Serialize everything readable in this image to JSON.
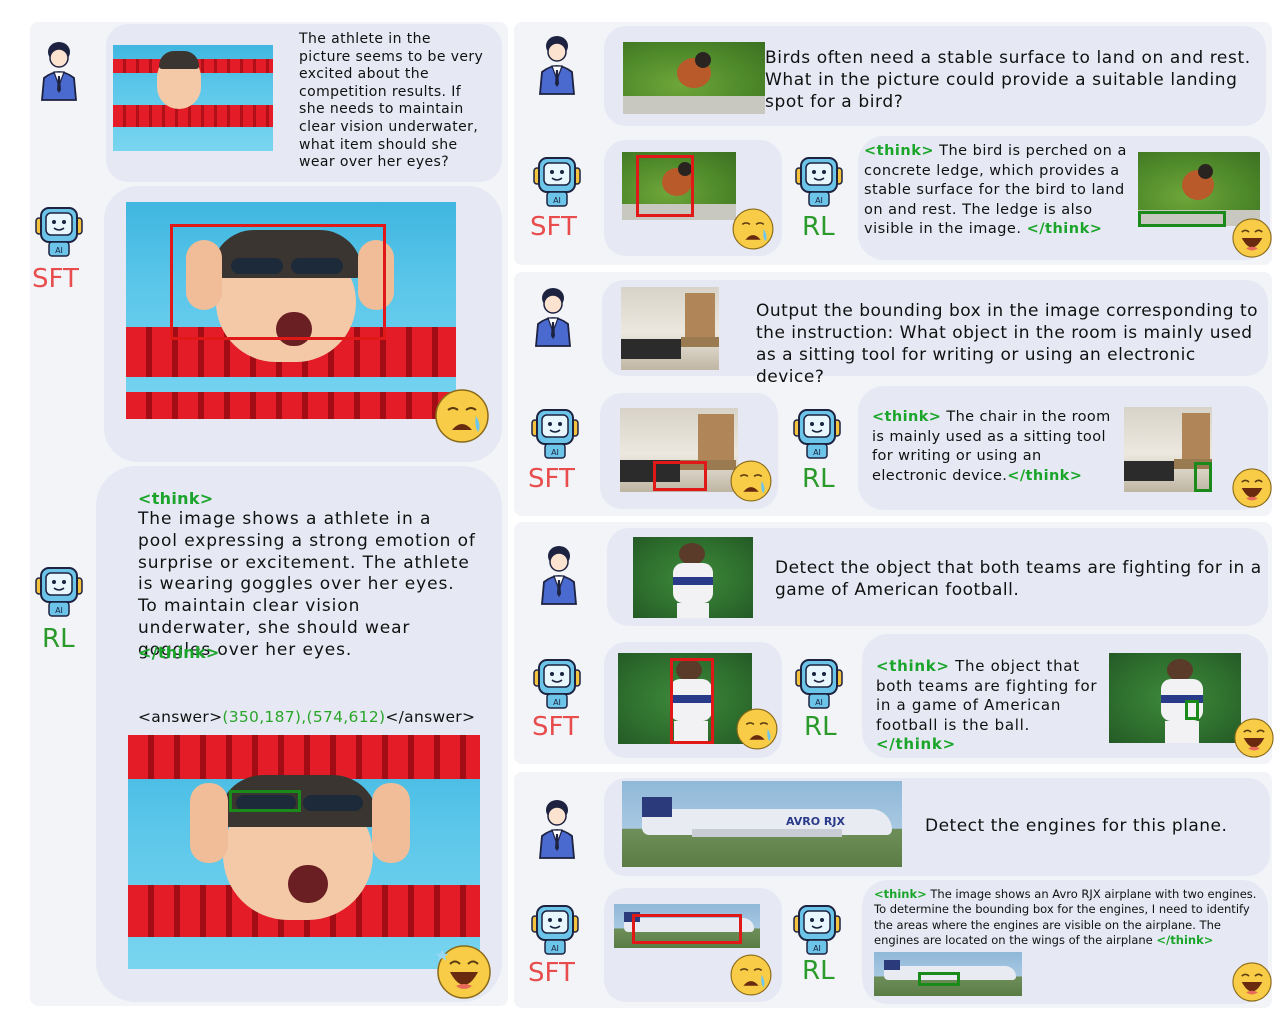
{
  "labels": {
    "sft": "SFT",
    "rl": "RL"
  },
  "colors": {
    "sft": "#e84c4c",
    "rl": "#2a9a2a",
    "think": "#1aa52a",
    "bbox_sft": "#e01818",
    "bbox_rl": "#1a8a1a"
  },
  "icons": {
    "user": "user-avatar-icon",
    "robot": "robot-ai-icon",
    "sad": "crying-face-icon",
    "happy": "happy-face-icon"
  },
  "left": {
    "question": "The athlete in the picture seems to be very excited about the competition results. If she needs to maintain clear vision underwater, what item should she wear over her eyes?",
    "rl_think_open": "<think>",
    "rl_text": "The image shows a athlete in a pool expressing a strong emotion of surprise or excitement. The athlete is wearing goggles over her eyes. To maintain clear vision underwater, she should wear goggles over her eyes.",
    "rl_think_close": "</think>",
    "answer_open": "<answer>",
    "answer_value": "(350,187),(574,612)",
    "answer_close": "</answer>"
  },
  "cases": [
    {
      "question": "Birds often need a stable surface to land on and rest. What in the picture could provide a suitable landing spot for a bird?",
      "think_open": "<think>",
      "rl_text": "The bird is perched on a concrete ledge, which provides a stable surface for the bird to land on and rest. The ledge is also visible in the image.",
      "think_close": "</think>"
    },
    {
      "question": "Output the bounding box in the image corresponding to the instruction: What object in the room is mainly used as a sitting tool for writing or using an electronic device?",
      "think_open": "<think>",
      "rl_text": "The chair in the room is mainly used as a sitting tool for writing or using an electronic device.",
      "think_close": "</think>"
    },
    {
      "question": "Detect the object that both teams are fighting for in a game of American football.",
      "think_open": "<think>",
      "rl_text": "The object that both teams are fighting for in a game of American football is the ball.",
      "think_close": "</think>"
    },
    {
      "question": "Detect the engines for this plane.",
      "think_open": "<think>",
      "rl_text": "The image shows an Avro RJX airplane with two engines. To determine the bounding box for the engines, I need to identify the areas where the engines are visible on the airplane. The engines are located on the wings of the airplane",
      "think_close": "</think>",
      "plane_text": "AVRO RJX"
    }
  ]
}
